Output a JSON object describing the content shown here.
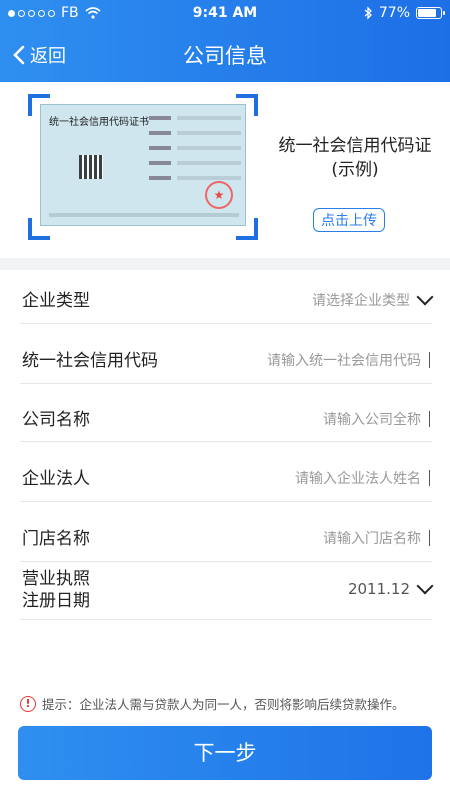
{
  "status_bar": {
    "carrier": "FB",
    "time": "9:41 AM",
    "battery": "77%",
    "battery_level": 0.77
  },
  "navbar": {
    "back_label": "返回",
    "title": "公司信息"
  },
  "certificate": {
    "doc_title": "统一社会信用代码证书",
    "caption_line1": "统一社会信用代码证",
    "caption_line2": "(示例)",
    "upload_label": "点击上传"
  },
  "form": {
    "rows": [
      {
        "label": "企业类型",
        "placeholder": "请选择企业类型",
        "type": "select"
      },
      {
        "label": "统一社会信用代码",
        "placeholder": "请输入统一社会信用代码",
        "type": "input"
      },
      {
        "label": "公司名称",
        "placeholder": "请输入公司全称",
        "type": "input"
      },
      {
        "label": "企业法人",
        "placeholder": "请输入企业法人姓名",
        "type": "input"
      },
      {
        "label": "门店名称",
        "placeholder": "请输入门店名称",
        "type": "input"
      },
      {
        "label_line1": "营业执照",
        "label_line2": "注册日期",
        "value": "2011.12",
        "type": "select"
      }
    ]
  },
  "notice": {
    "text": "提示：企业法人需与贷款人为同一人，否则将影响后续贷款操作。"
  },
  "next_button": {
    "label": "下一步"
  },
  "colors": {
    "accent": "#1e73e8",
    "warning": "#e33333"
  }
}
